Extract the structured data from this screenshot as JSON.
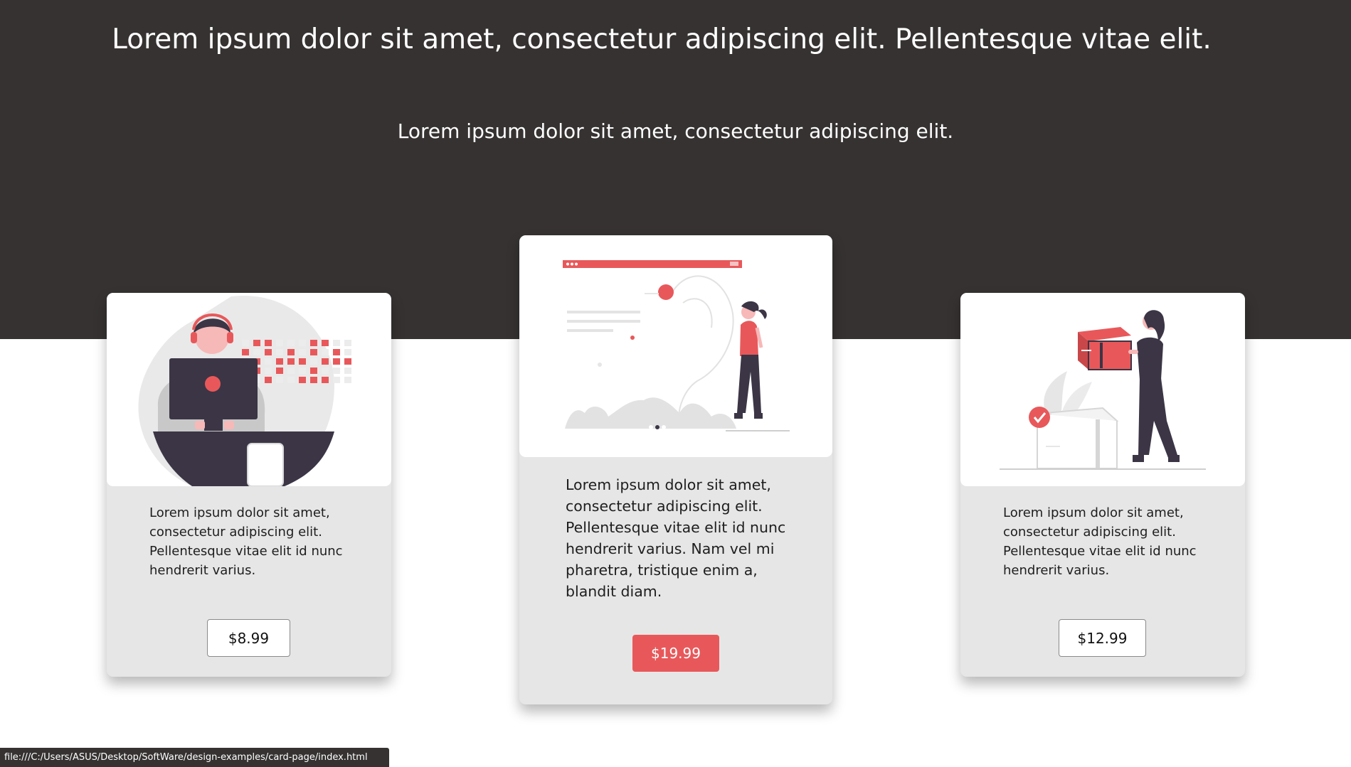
{
  "hero": {
    "title": "Lorem ipsum dolor sit amet, consectetur adipiscing elit. Pellentesque vitae elit.",
    "subtitle": "Lorem ipsum dolor sit amet, consectetur adipiscing elit."
  },
  "cards": [
    {
      "illustration": "person-at-computer-illustration",
      "text": "Lorem ipsum dolor sit amet, consectetur adipiscing elit. Pellentesque vitae elit id nunc hendrerit varius.",
      "price": "$8.99"
    },
    {
      "illustration": "woman-with-browser-window-illustration",
      "text": "Lorem ipsum dolor sit amet, consectetur adipiscing elit. Pellentesque vitae elit id nunc hendrerit varius. Nam vel mi pharetra, tristique enim a, blandit diam.",
      "price": "$19.99"
    },
    {
      "illustration": "woman-carrying-package-illustration",
      "text": "Lorem ipsum dolor sit amet, consectetur adipiscing elit. Pellentesque vitae elit id nunc hendrerit varius.",
      "price": "$12.99"
    }
  ],
  "status_bar": {
    "url": "file:///C:/Users/ASUS/Desktop/SoftWare/design-examples/card-page/index.html"
  },
  "colors": {
    "hero_background": "#363232",
    "card_background": "#e6e6e6",
    "accent": "#e8585a"
  }
}
